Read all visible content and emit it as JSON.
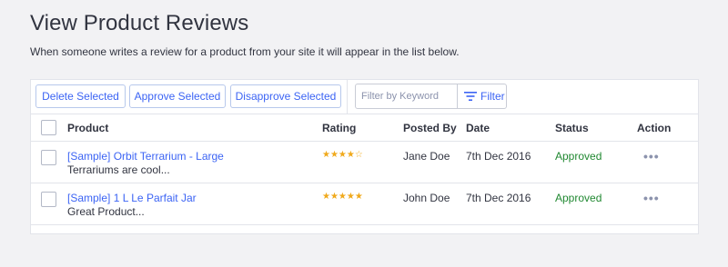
{
  "page": {
    "title": "View Product Reviews",
    "description": "When someone writes a review for a product from your site it will appear in the list below."
  },
  "toolbar": {
    "delete_label": "Delete Selected",
    "approve_label": "Approve Selected",
    "disapprove_label": "Disapprove Selected",
    "search_placeholder": "Filter by Keyword",
    "filter_label": "Filter"
  },
  "table": {
    "headers": {
      "product": "Product",
      "rating": "Rating",
      "posted_by": "Posted By",
      "date": "Date",
      "status": "Status",
      "action": "Action"
    },
    "rows": [
      {
        "product": "[Sample] Orbit Terrarium - Large",
        "excerpt": "Terrariums are cool...",
        "rating": 4,
        "rating_stars": "★★★★☆",
        "posted_by": "Jane Doe",
        "date": "7th Dec 2016",
        "status": "Approved",
        "action": "•••"
      },
      {
        "product": "[Sample] 1 L Le Parfait Jar",
        "excerpt": "Great Product...",
        "rating": 5,
        "rating_stars": "★★★★★",
        "posted_by": "John Doe",
        "date": "7th Dec 2016",
        "status": "Approved",
        "action": "•••"
      }
    ]
  },
  "colors": {
    "accent": "#3c64f4",
    "status_approved": "#208831",
    "star": "#f0a91b"
  },
  "icons": {
    "filter": "filter-icon",
    "more": "more-options-icon"
  }
}
